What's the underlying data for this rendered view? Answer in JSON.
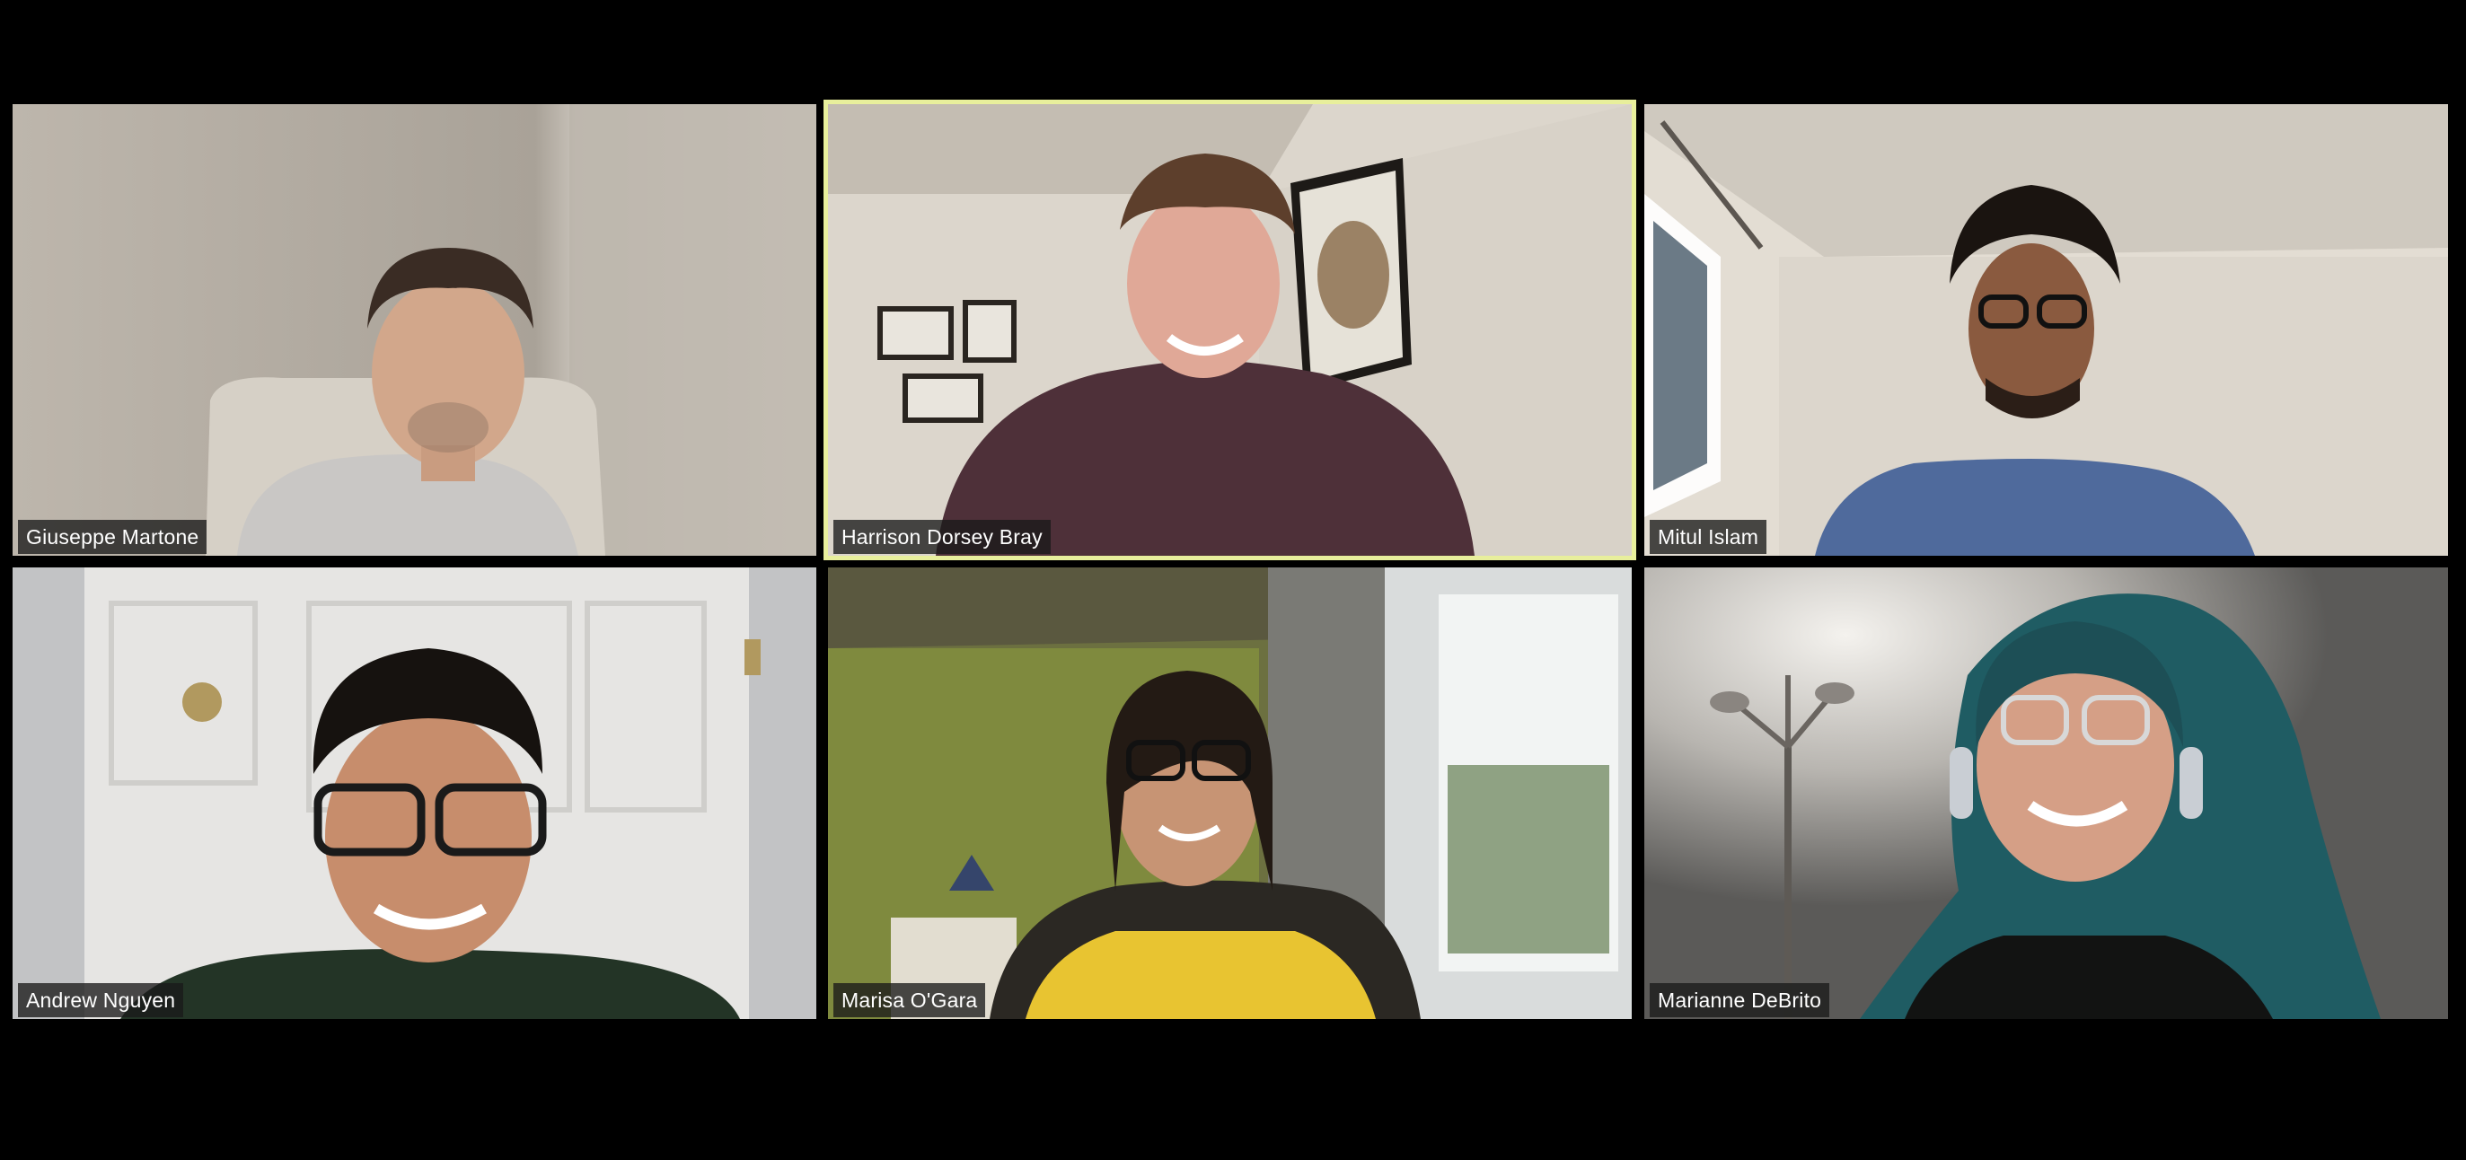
{
  "meeting": {
    "view": "gallery",
    "active_speaker_border_color": "#e8ef9c",
    "background_color": "#000000"
  },
  "participants": [
    {
      "name": "Giuseppe Martone",
      "active_speaker": false
    },
    {
      "name": "Harrison Dorsey Bray",
      "active_speaker": true
    },
    {
      "name": "Mitul Islam",
      "active_speaker": false
    },
    {
      "name": "Andrew Nguyen",
      "active_speaker": false
    },
    {
      "name": "Marisa O'Gara",
      "active_speaker": false
    },
    {
      "name": "Marianne DeBrito",
      "active_speaker": false
    }
  ]
}
